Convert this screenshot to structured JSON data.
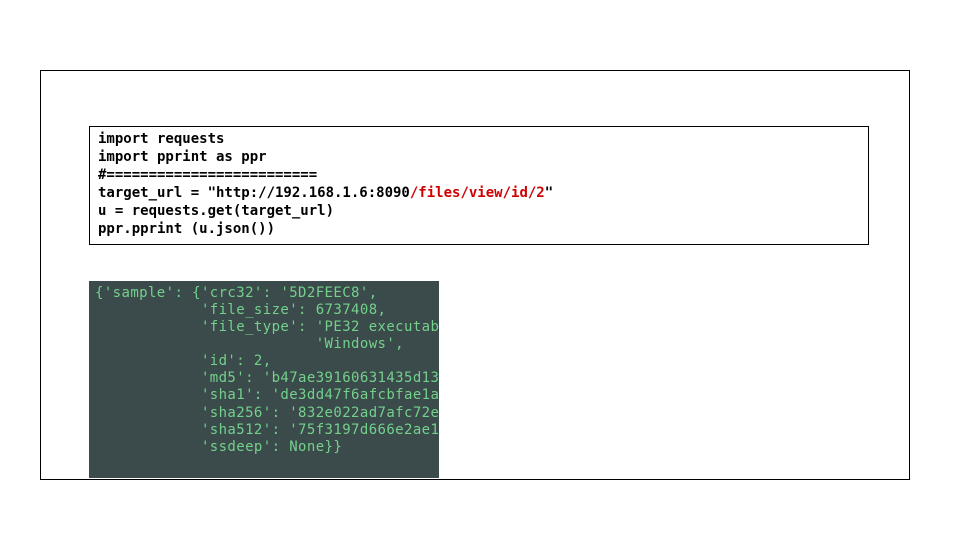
{
  "code": {
    "l1": "import requests",
    "l2": "import pprint as ppr",
    "l3": "#=========================",
    "l4_prefix": "target_url = \"http://192.168.1.6:8090",
    "l4_red": "/files/view/id/2",
    "l4_suffix": "\"",
    "l5": "u = requests.get(target_url)",
    "l6": "ppr.pprint (u.json())"
  },
  "output": {
    "l1": "{'sample': {'crc32': '5D2FEEC8',",
    "l2": "            'file_size': 6737408,",
    "l3": "            'file_type': 'PE32 executab",
    "l4": "                         'Windows',",
    "l5": "            'id': 2,",
    "l6": "            'md5': 'b47ae39160631435d13",
    "l7": "            'sha1': 'de3dd47f6afcbfae1a",
    "l8": "            'sha256': '832e022ad7afc72e",
    "l9": "            'sha512': '75f3197d666e2ae1",
    "l10": "            'ssdeep': None}}"
  }
}
